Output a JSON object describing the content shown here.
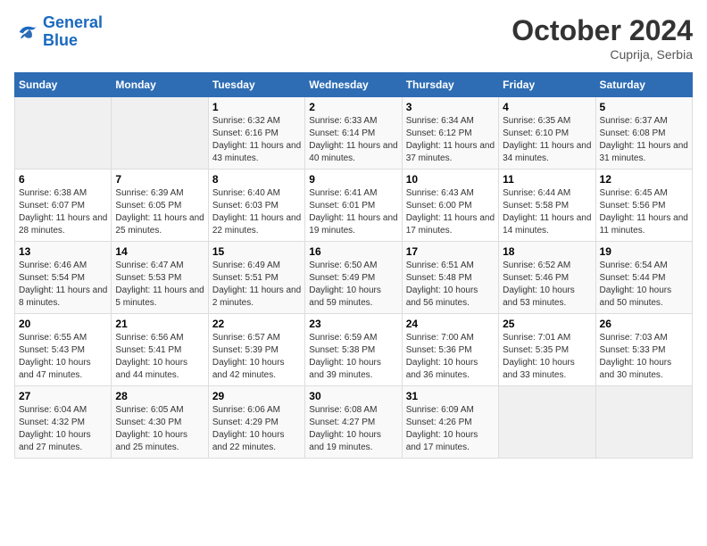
{
  "logo": {
    "line1": "General",
    "line2": "Blue"
  },
  "title": "October 2024",
  "location": "Cuprija, Serbia",
  "days_header": [
    "Sunday",
    "Monday",
    "Tuesday",
    "Wednesday",
    "Thursday",
    "Friday",
    "Saturday"
  ],
  "weeks": [
    [
      {
        "day": "",
        "sunrise": "",
        "sunset": "",
        "daylight": ""
      },
      {
        "day": "",
        "sunrise": "",
        "sunset": "",
        "daylight": ""
      },
      {
        "day": "1",
        "sunrise": "Sunrise: 6:32 AM",
        "sunset": "Sunset: 6:16 PM",
        "daylight": "Daylight: 11 hours and 43 minutes."
      },
      {
        "day": "2",
        "sunrise": "Sunrise: 6:33 AM",
        "sunset": "Sunset: 6:14 PM",
        "daylight": "Daylight: 11 hours and 40 minutes."
      },
      {
        "day": "3",
        "sunrise": "Sunrise: 6:34 AM",
        "sunset": "Sunset: 6:12 PM",
        "daylight": "Daylight: 11 hours and 37 minutes."
      },
      {
        "day": "4",
        "sunrise": "Sunrise: 6:35 AM",
        "sunset": "Sunset: 6:10 PM",
        "daylight": "Daylight: 11 hours and 34 minutes."
      },
      {
        "day": "5",
        "sunrise": "Sunrise: 6:37 AM",
        "sunset": "Sunset: 6:08 PM",
        "daylight": "Daylight: 11 hours and 31 minutes."
      }
    ],
    [
      {
        "day": "6",
        "sunrise": "Sunrise: 6:38 AM",
        "sunset": "Sunset: 6:07 PM",
        "daylight": "Daylight: 11 hours and 28 minutes."
      },
      {
        "day": "7",
        "sunrise": "Sunrise: 6:39 AM",
        "sunset": "Sunset: 6:05 PM",
        "daylight": "Daylight: 11 hours and 25 minutes."
      },
      {
        "day": "8",
        "sunrise": "Sunrise: 6:40 AM",
        "sunset": "Sunset: 6:03 PM",
        "daylight": "Daylight: 11 hours and 22 minutes."
      },
      {
        "day": "9",
        "sunrise": "Sunrise: 6:41 AM",
        "sunset": "Sunset: 6:01 PM",
        "daylight": "Daylight: 11 hours and 19 minutes."
      },
      {
        "day": "10",
        "sunrise": "Sunrise: 6:43 AM",
        "sunset": "Sunset: 6:00 PM",
        "daylight": "Daylight: 11 hours and 17 minutes."
      },
      {
        "day": "11",
        "sunrise": "Sunrise: 6:44 AM",
        "sunset": "Sunset: 5:58 PM",
        "daylight": "Daylight: 11 hours and 14 minutes."
      },
      {
        "day": "12",
        "sunrise": "Sunrise: 6:45 AM",
        "sunset": "Sunset: 5:56 PM",
        "daylight": "Daylight: 11 hours and 11 minutes."
      }
    ],
    [
      {
        "day": "13",
        "sunrise": "Sunrise: 6:46 AM",
        "sunset": "Sunset: 5:54 PM",
        "daylight": "Daylight: 11 hours and 8 minutes."
      },
      {
        "day": "14",
        "sunrise": "Sunrise: 6:47 AM",
        "sunset": "Sunset: 5:53 PM",
        "daylight": "Daylight: 11 hours and 5 minutes."
      },
      {
        "day": "15",
        "sunrise": "Sunrise: 6:49 AM",
        "sunset": "Sunset: 5:51 PM",
        "daylight": "Daylight: 11 hours and 2 minutes."
      },
      {
        "day": "16",
        "sunrise": "Sunrise: 6:50 AM",
        "sunset": "Sunset: 5:49 PM",
        "daylight": "Daylight: 10 hours and 59 minutes."
      },
      {
        "day": "17",
        "sunrise": "Sunrise: 6:51 AM",
        "sunset": "Sunset: 5:48 PM",
        "daylight": "Daylight: 10 hours and 56 minutes."
      },
      {
        "day": "18",
        "sunrise": "Sunrise: 6:52 AM",
        "sunset": "Sunset: 5:46 PM",
        "daylight": "Daylight: 10 hours and 53 minutes."
      },
      {
        "day": "19",
        "sunrise": "Sunrise: 6:54 AM",
        "sunset": "Sunset: 5:44 PM",
        "daylight": "Daylight: 10 hours and 50 minutes."
      }
    ],
    [
      {
        "day": "20",
        "sunrise": "Sunrise: 6:55 AM",
        "sunset": "Sunset: 5:43 PM",
        "daylight": "Daylight: 10 hours and 47 minutes."
      },
      {
        "day": "21",
        "sunrise": "Sunrise: 6:56 AM",
        "sunset": "Sunset: 5:41 PM",
        "daylight": "Daylight: 10 hours and 44 minutes."
      },
      {
        "day": "22",
        "sunrise": "Sunrise: 6:57 AM",
        "sunset": "Sunset: 5:39 PM",
        "daylight": "Daylight: 10 hours and 42 minutes."
      },
      {
        "day": "23",
        "sunrise": "Sunrise: 6:59 AM",
        "sunset": "Sunset: 5:38 PM",
        "daylight": "Daylight: 10 hours and 39 minutes."
      },
      {
        "day": "24",
        "sunrise": "Sunrise: 7:00 AM",
        "sunset": "Sunset: 5:36 PM",
        "daylight": "Daylight: 10 hours and 36 minutes."
      },
      {
        "day": "25",
        "sunrise": "Sunrise: 7:01 AM",
        "sunset": "Sunset: 5:35 PM",
        "daylight": "Daylight: 10 hours and 33 minutes."
      },
      {
        "day": "26",
        "sunrise": "Sunrise: 7:03 AM",
        "sunset": "Sunset: 5:33 PM",
        "daylight": "Daylight: 10 hours and 30 minutes."
      }
    ],
    [
      {
        "day": "27",
        "sunrise": "Sunrise: 6:04 AM",
        "sunset": "Sunset: 4:32 PM",
        "daylight": "Daylight: 10 hours and 27 minutes."
      },
      {
        "day": "28",
        "sunrise": "Sunrise: 6:05 AM",
        "sunset": "Sunset: 4:30 PM",
        "daylight": "Daylight: 10 hours and 25 minutes."
      },
      {
        "day": "29",
        "sunrise": "Sunrise: 6:06 AM",
        "sunset": "Sunset: 4:29 PM",
        "daylight": "Daylight: 10 hours and 22 minutes."
      },
      {
        "day": "30",
        "sunrise": "Sunrise: 6:08 AM",
        "sunset": "Sunset: 4:27 PM",
        "daylight": "Daylight: 10 hours and 19 minutes."
      },
      {
        "day": "31",
        "sunrise": "Sunrise: 6:09 AM",
        "sunset": "Sunset: 4:26 PM",
        "daylight": "Daylight: 10 hours and 17 minutes."
      },
      {
        "day": "",
        "sunrise": "",
        "sunset": "",
        "daylight": ""
      },
      {
        "day": "",
        "sunrise": "",
        "sunset": "",
        "daylight": ""
      }
    ]
  ]
}
